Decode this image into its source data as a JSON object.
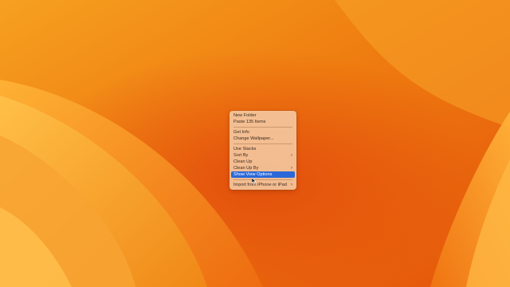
{
  "desktop": {
    "background_color": "#f18a12",
    "accent_color": "#2a68d9"
  },
  "context_menu": {
    "groups": [
      [
        {
          "label": "New Folder",
          "submenu": false,
          "highlighted": false
        },
        {
          "label": "Paste 135 Items",
          "submenu": false,
          "highlighted": false
        }
      ],
      [
        {
          "label": "Get Info",
          "submenu": false,
          "highlighted": false
        },
        {
          "label": "Change Wallpaper...",
          "submenu": false,
          "highlighted": false
        }
      ],
      [
        {
          "label": "Use Stacks",
          "submenu": false,
          "highlighted": false
        },
        {
          "label": "Sort By",
          "submenu": true,
          "highlighted": false
        },
        {
          "label": "Clean Up",
          "submenu": false,
          "highlighted": false
        },
        {
          "label": "Clean Up By",
          "submenu": true,
          "highlighted": false
        },
        {
          "label": "Show View Options",
          "submenu": false,
          "highlighted": true
        }
      ],
      [
        {
          "label": "Import from iPhone or iPad",
          "submenu": true,
          "highlighted": false
        }
      ]
    ],
    "submenu_icon": "chevron-right-icon"
  }
}
